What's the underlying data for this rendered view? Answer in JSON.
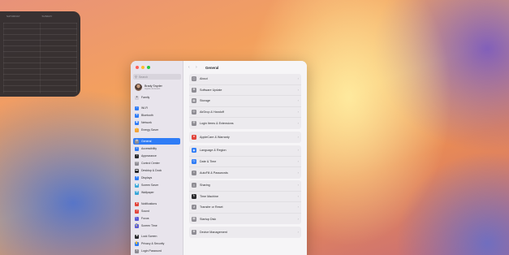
{
  "calendar_widget": {
    "day_labels": [
      "SATURDAY",
      "SUNDAY"
    ]
  },
  "window": {
    "title": "General",
    "search": {
      "placeholder": "Search"
    },
    "profile": {
      "name": "Brady Snyder",
      "subtitle": "Apple Account"
    },
    "sidebar": {
      "family_label": "Family",
      "items": [
        {
          "label": "Wi-Fi",
          "icon": "wifi-icon"
        },
        {
          "label": "Bluetooth",
          "icon": "bluetooth-icon"
        },
        {
          "label": "Network",
          "icon": "network-icon"
        },
        {
          "label": "Energy Saver",
          "icon": "energy-icon"
        },
        {
          "label": "General",
          "icon": "gear-icon",
          "selected": true
        },
        {
          "label": "Accessibility",
          "icon": "accessibility-icon"
        },
        {
          "label": "Appearance",
          "icon": "appearance-icon"
        },
        {
          "label": "Control Center",
          "icon": "control-center-icon"
        },
        {
          "label": "Desktop & Dock",
          "icon": "dock-icon"
        },
        {
          "label": "Displays",
          "icon": "display-icon"
        },
        {
          "label": "Screen Saver",
          "icon": "screen-saver-icon"
        },
        {
          "label": "Wallpaper",
          "icon": "wallpaper-icon"
        },
        {
          "label": "Notifications",
          "icon": "bell-icon"
        },
        {
          "label": "Sound",
          "icon": "speaker-icon"
        },
        {
          "label": "Focus",
          "icon": "moon-icon"
        },
        {
          "label": "Screen Time",
          "icon": "hourglass-icon"
        },
        {
          "label": "Lock Screen",
          "icon": "lock-icon"
        },
        {
          "label": "Privacy & Security",
          "icon": "hand-icon"
        },
        {
          "label": "Login Password",
          "icon": "key-icon"
        }
      ]
    },
    "groups": [
      {
        "rows": [
          {
            "label": "About",
            "icon": "info-icon"
          },
          {
            "label": "Software Update",
            "icon": "gear-badge-icon"
          },
          {
            "label": "Storage",
            "icon": "storage-icon"
          },
          {
            "label": "AirDrop & Handoff",
            "icon": "airdrop-icon"
          },
          {
            "label": "Login Items & Extensions",
            "icon": "list-icon"
          }
        ]
      },
      {
        "rows": [
          {
            "label": "AppleCare & Warranty",
            "icon": "apple-icon"
          }
        ]
      },
      {
        "rows": [
          {
            "label": "Language & Region",
            "icon": "globe-icon"
          },
          {
            "label": "Date & Time",
            "icon": "clock-icon"
          },
          {
            "label": "AutoFill & Passwords",
            "icon": "key-icon"
          }
        ]
      },
      {
        "rows": [
          {
            "label": "Sharing",
            "icon": "sharing-icon"
          },
          {
            "label": "Time Machine",
            "icon": "time-machine-icon"
          },
          {
            "label": "Transfer or Reset",
            "icon": "reset-icon"
          },
          {
            "label": "Startup Disk",
            "icon": "disk-icon"
          }
        ]
      },
      {
        "rows": [
          {
            "label": "Device Management",
            "icon": "device-management-icon"
          }
        ]
      }
    ]
  }
}
